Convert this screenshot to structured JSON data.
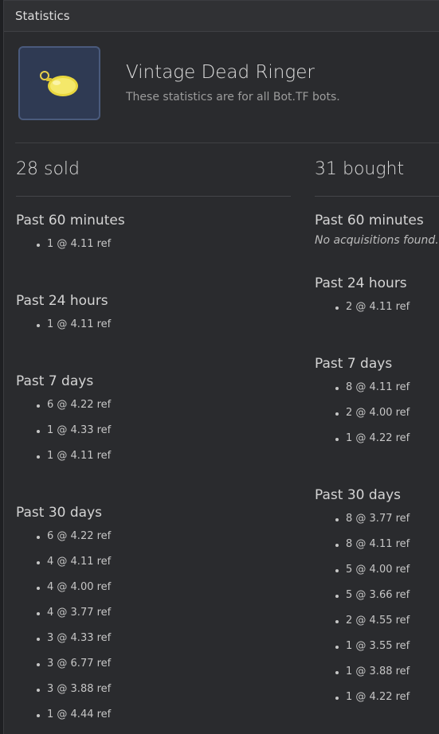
{
  "panel": {
    "title": "Statistics"
  },
  "item": {
    "name": "Vintage Dead Ringer",
    "subtitle": "These statistics are for all Bot.TF bots.",
    "icon": "dead-ringer-watch-icon",
    "accent": "#4a5a7c"
  },
  "sold": {
    "title": "28 sold",
    "sections": [
      {
        "label": "Past 60 minutes",
        "entries": [
          "1 @ 4.11 ref"
        ]
      },
      {
        "label": "Past 24 hours",
        "entries": [
          "1 @ 4.11 ref"
        ]
      },
      {
        "label": "Past 7 days",
        "entries": [
          "6 @ 4.22 ref",
          "1 @ 4.33 ref",
          "1 @ 4.11 ref"
        ]
      },
      {
        "label": "Past 30 days",
        "entries": [
          "6 @ 4.22 ref",
          "4 @ 4.11 ref",
          "4 @ 4.00 ref",
          "4 @ 3.77 ref",
          "3 @ 4.33 ref",
          "3 @ 6.77 ref",
          "3 @ 3.88 ref",
          "1 @ 4.44 ref"
        ]
      }
    ]
  },
  "bought": {
    "title": "31 bought",
    "sections": [
      {
        "label": "Past 60 minutes",
        "empty": "No acquisitions found.",
        "entries": []
      },
      {
        "label": "Past 24 hours",
        "entries": [
          "2 @ 4.11 ref"
        ]
      },
      {
        "label": "Past 7 days",
        "entries": [
          "8 @ 4.11 ref",
          "2 @ 4.00 ref",
          "1 @ 4.22 ref"
        ]
      },
      {
        "label": "Past 30 days",
        "entries": [
          "8 @ 3.77 ref",
          "8 @ 4.11 ref",
          "5 @ 4.00 ref",
          "5 @ 3.66 ref",
          "2 @ 4.55 ref",
          "1 @ 3.55 ref",
          "1 @ 3.88 ref",
          "1 @ 4.22 ref"
        ]
      }
    ]
  }
}
